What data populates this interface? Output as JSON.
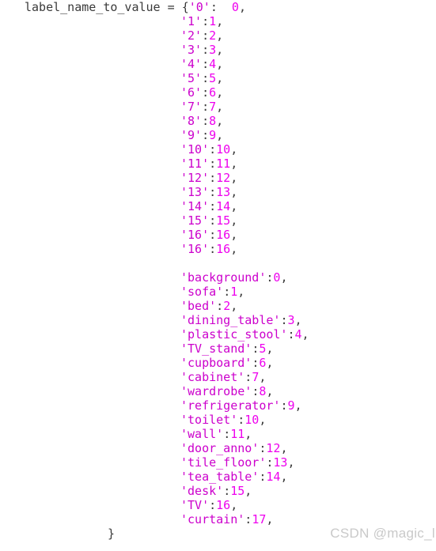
{
  "code": {
    "variable_name": "label_name_to_value",
    "assign_operator": "=",
    "open_brace": "{",
    "close_brace": "}",
    "colon": ":",
    "colon_spaced": ":  ",
    "comma": ",",
    "quote": "'",
    "first_entry": {
      "key": "0",
      "value": "0"
    },
    "numeric_entries": [
      {
        "key": "1",
        "value": "1"
      },
      {
        "key": "2",
        "value": "2"
      },
      {
        "key": "3",
        "value": "3"
      },
      {
        "key": "4",
        "value": "4"
      },
      {
        "key": "5",
        "value": "5"
      },
      {
        "key": "6",
        "value": "6"
      },
      {
        "key": "7",
        "value": "7"
      },
      {
        "key": "8",
        "value": "8"
      },
      {
        "key": "9",
        "value": "9"
      },
      {
        "key": "10",
        "value": "10"
      },
      {
        "key": "11",
        "value": "11"
      },
      {
        "key": "12",
        "value": "12"
      },
      {
        "key": "13",
        "value": "13"
      },
      {
        "key": "14",
        "value": "14"
      },
      {
        "key": "15",
        "value": "15"
      },
      {
        "key": "16",
        "value": "16"
      },
      {
        "key": "16",
        "value": "16"
      }
    ],
    "named_entries": [
      {
        "key": "background",
        "value": "0"
      },
      {
        "key": "sofa",
        "value": "1"
      },
      {
        "key": "bed",
        "value": "2"
      },
      {
        "key": "dining_table",
        "value": "3"
      },
      {
        "key": "plastic_stool",
        "value": "4"
      },
      {
        "key": "TV_stand",
        "value": "5"
      },
      {
        "key": "cupboard",
        "value": "6"
      },
      {
        "key": "cabinet",
        "value": "7"
      },
      {
        "key": "wardrobe",
        "value": "8"
      },
      {
        "key": "refrigerator",
        "value": "9"
      },
      {
        "key": "toilet",
        "value": "10"
      },
      {
        "key": "wall",
        "value": "11"
      },
      {
        "key": "door_anno",
        "value": "12"
      },
      {
        "key": "tile_floor",
        "value": "13"
      },
      {
        "key": "tea_table",
        "value": "14"
      },
      {
        "key": "desk",
        "value": "15"
      },
      {
        "key": "TV",
        "value": "16"
      },
      {
        "key": "curtain",
        "value": "17"
      }
    ]
  },
  "watermark": {
    "text": "CSDN @magic_ll"
  },
  "colors": {
    "background": "#ffffff",
    "plain_text": "#3a3a3a",
    "string_token": "#cc00cc",
    "number_token": "#ee00ee",
    "watermark": "#c9c9c9"
  }
}
